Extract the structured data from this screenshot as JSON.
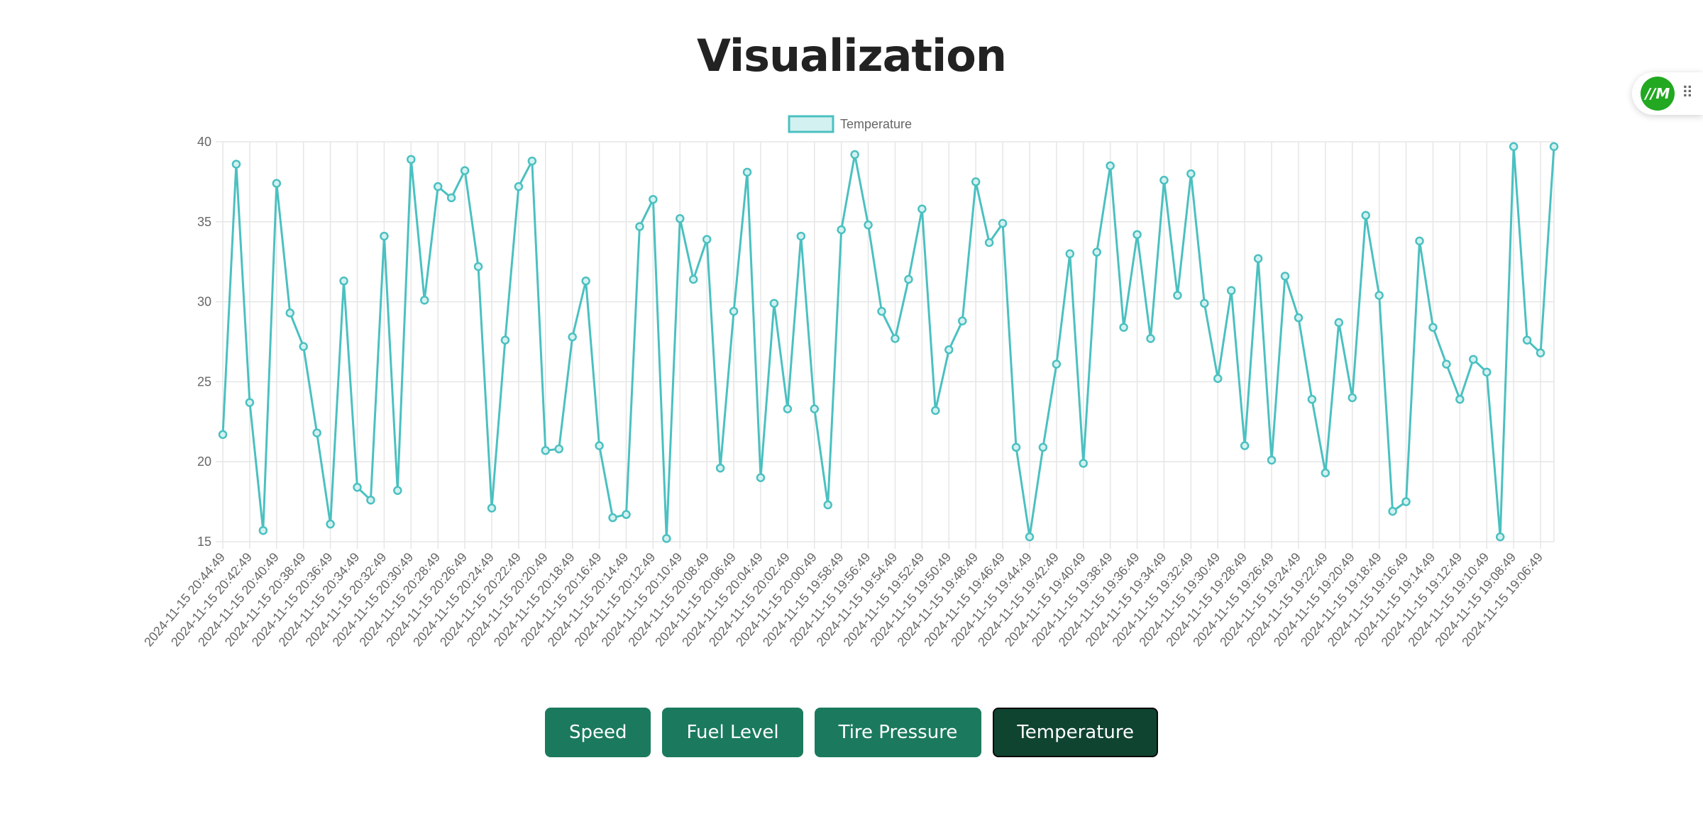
{
  "page": {
    "title": "Visualization"
  },
  "buttons": [
    {
      "label": "Speed",
      "active": false
    },
    {
      "label": "Fuel Level",
      "active": false
    },
    {
      "label": "Tire Pressure",
      "active": false
    },
    {
      "label": "Temperature",
      "active": true
    }
  ],
  "extension": {
    "logo_text": "//M",
    "icon": "drag-grip-icon"
  },
  "chart_data": {
    "type": "line",
    "title": "",
    "xlabel": "",
    "ylabel": "",
    "ylim": [
      15,
      40
    ],
    "yticks": [
      15,
      20,
      25,
      30,
      35,
      40
    ],
    "grid": true,
    "legend_position": "top",
    "series": [
      {
        "name": "Temperature",
        "color": "#4bc0c0",
        "fill": "#d4f1f1",
        "values": [
          21.7,
          38.6,
          23.7,
          15.7,
          37.4,
          29.3,
          27.2,
          21.8,
          16.1,
          31.3,
          18.4,
          17.6,
          34.1,
          18.2,
          38.9,
          30.1,
          37.2,
          36.5,
          38.2,
          32.2,
          17.1,
          27.6,
          37.2,
          38.8,
          20.7,
          20.8,
          27.8,
          31.3,
          21.0,
          16.5,
          16.7,
          34.7,
          36.4,
          15.2,
          35.2,
          31.4,
          33.9,
          19.6,
          29.4,
          38.1,
          19.0,
          29.9,
          23.3,
          34.1,
          23.3,
          17.3,
          34.5,
          39.2,
          34.8,
          29.4,
          27.7,
          31.4,
          35.8,
          23.2,
          27.0,
          28.8,
          37.5,
          33.7,
          34.9,
          20.9,
          15.3,
          20.9,
          26.1,
          33.0,
          19.9,
          33.1,
          38.5,
          28.4,
          34.2,
          27.7,
          37.6,
          30.4,
          38.0,
          29.9,
          25.2,
          30.7,
          21.0,
          32.7,
          20.1,
          31.6,
          29.0,
          23.9,
          19.3,
          28.7,
          24.0,
          35.4,
          30.4,
          16.9,
          17.5,
          33.8,
          28.4,
          26.1,
          23.9,
          26.4,
          25.6,
          15.3,
          39.7,
          27.6,
          26.8,
          39.7
        ]
      }
    ],
    "x_tick_labels": [
      "2024-11-15 20:44:49",
      "2024-11-15 20:42:49",
      "2024-11-15 20:40:49",
      "2024-11-15 20:38:49",
      "2024-11-15 20:36:49",
      "2024-11-15 20:34:49",
      "2024-11-15 20:32:49",
      "2024-11-15 20:30:49",
      "2024-11-15 20:28:49",
      "2024-11-15 20:26:49",
      "2024-11-15 20:24:49",
      "2024-11-15 20:22:49",
      "2024-11-15 20:20:49",
      "2024-11-15 20:18:49",
      "2024-11-15 20:16:49",
      "2024-11-15 20:14:49",
      "2024-11-15 20:12:49",
      "2024-11-15 20:10:49",
      "2024-11-15 20:08:49",
      "2024-11-15 20:06:49",
      "2024-11-15 20:04:49",
      "2024-11-15 20:02:49",
      "2024-11-15 20:00:49",
      "2024-11-15 19:58:49",
      "2024-11-15 19:56:49",
      "2024-11-15 19:54:49",
      "2024-11-15 19:52:49",
      "2024-11-15 19:50:49",
      "2024-11-15 19:48:49",
      "2024-11-15 19:46:49",
      "2024-11-15 19:44:49",
      "2024-11-15 19:42:49",
      "2024-11-15 19:40:49",
      "2024-11-15 19:38:49",
      "2024-11-15 19:36:49",
      "2024-11-15 19:34:49",
      "2024-11-15 19:32:49",
      "2024-11-15 19:30:49",
      "2024-11-15 19:28:49",
      "2024-11-15 19:26:49",
      "2024-11-15 19:24:49",
      "2024-11-15 19:22:49",
      "2024-11-15 19:20:49",
      "2024-11-15 19:18:49",
      "2024-11-15 19:16:49",
      "2024-11-15 19:14:49",
      "2024-11-15 19:12:49",
      "2024-11-15 19:10:49",
      "2024-11-15 19:08:49",
      "2024-11-15 19:06:49"
    ]
  }
}
